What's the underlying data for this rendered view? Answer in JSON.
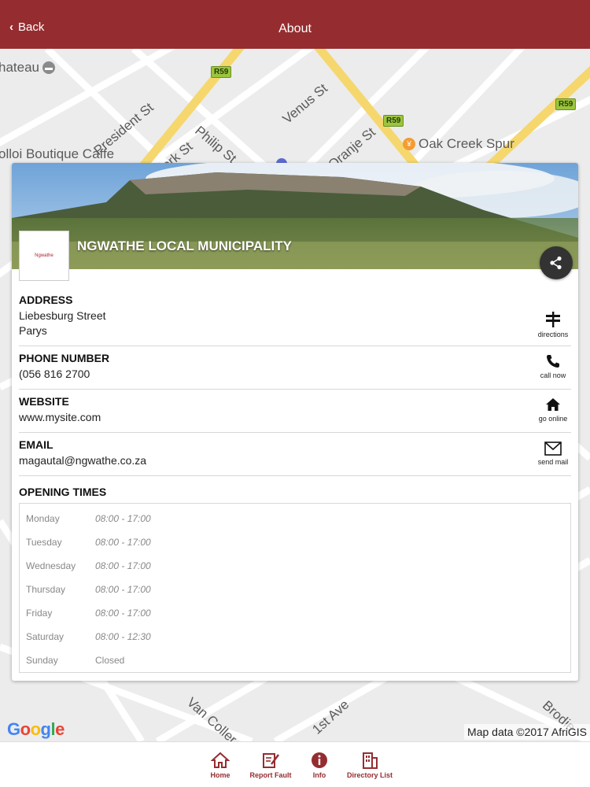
{
  "header": {
    "back_label": "Back",
    "title": "About"
  },
  "map": {
    "labels": {
      "chateau": "hateau",
      "president": "President St",
      "philip": "Philip St",
      "venus": "Venus St",
      "oranje": "Oranje St",
      "kerk": "Kerk St",
      "boutique": "olloi Boutique Caffe",
      "oak": "Oak Creek Spur",
      "vancoller": "Van Coller",
      "first_ave": "1st Ave",
      "brodie": "Brodie"
    },
    "shields": [
      "R59",
      "R59",
      "R59"
    ],
    "google": "Google",
    "attribution": "Map data ©2017 AfriGIS"
  },
  "listing": {
    "name": "NGWATHE LOCAL MUNICIPALITY",
    "address": {
      "label": "ADDRESS",
      "line1": "Liebesburg Street",
      "line2": "Parys",
      "action": "directions"
    },
    "phone": {
      "label": "PHONE NUMBER",
      "value": "(056 816 2700",
      "action": "call now"
    },
    "website": {
      "label": "WEBSITE",
      "value": "www.mysite.com",
      "action": "go online"
    },
    "email": {
      "label": "EMAIL",
      "value": "magautal@ngwathe.co.za",
      "action": "send mail"
    },
    "opening_label": "OPENING TIMES",
    "hours": [
      {
        "day": "Monday",
        "time": "08:00 - 17:00"
      },
      {
        "day": "Tuesday",
        "time": "08:00 - 17:00"
      },
      {
        "day": "Wednesday",
        "time": "08:00 - 17:00"
      },
      {
        "day": "Thursday",
        "time": "08:00 - 17:00"
      },
      {
        "day": "Friday",
        "time": "08:00 - 17:00"
      },
      {
        "day": "Saturday",
        "time": "08:00 - 12:30"
      },
      {
        "day": "Sunday",
        "time": "Closed"
      }
    ]
  },
  "nav": {
    "home": "Home",
    "report": "Report Fault",
    "info": "Info",
    "directory": "Directory List"
  },
  "colors": {
    "brand": "#952d30",
    "road": "#f5d76e",
    "shield": "#9bc53d"
  }
}
